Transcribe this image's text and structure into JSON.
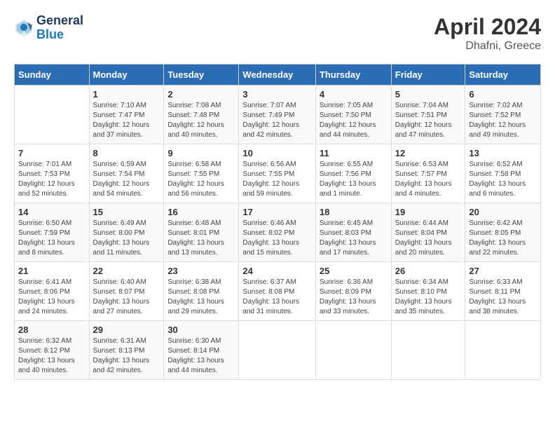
{
  "header": {
    "logo_line1": "General",
    "logo_line2": "Blue",
    "title": "April 2024",
    "subtitle": "Dhafni, Greece"
  },
  "days_of_week": [
    "Sunday",
    "Monday",
    "Tuesday",
    "Wednesday",
    "Thursday",
    "Friday",
    "Saturday"
  ],
  "weeks": [
    [
      {
        "day": "",
        "info": ""
      },
      {
        "day": "1",
        "info": "Sunrise: 7:10 AM\nSunset: 7:47 PM\nDaylight: 12 hours\nand 37 minutes."
      },
      {
        "day": "2",
        "info": "Sunrise: 7:08 AM\nSunset: 7:48 PM\nDaylight: 12 hours\nand 40 minutes."
      },
      {
        "day": "3",
        "info": "Sunrise: 7:07 AM\nSunset: 7:49 PM\nDaylight: 12 hours\nand 42 minutes."
      },
      {
        "day": "4",
        "info": "Sunrise: 7:05 AM\nSunset: 7:50 PM\nDaylight: 12 hours\nand 44 minutes."
      },
      {
        "day": "5",
        "info": "Sunrise: 7:04 AM\nSunset: 7:51 PM\nDaylight: 12 hours\nand 47 minutes."
      },
      {
        "day": "6",
        "info": "Sunrise: 7:02 AM\nSunset: 7:52 PM\nDaylight: 12 hours\nand 49 minutes."
      }
    ],
    [
      {
        "day": "7",
        "info": "Sunrise: 7:01 AM\nSunset: 7:53 PM\nDaylight: 12 hours\nand 52 minutes."
      },
      {
        "day": "8",
        "info": "Sunrise: 6:59 AM\nSunset: 7:54 PM\nDaylight: 12 hours\nand 54 minutes."
      },
      {
        "day": "9",
        "info": "Sunrise: 6:58 AM\nSunset: 7:55 PM\nDaylight: 12 hours\nand 56 minutes."
      },
      {
        "day": "10",
        "info": "Sunrise: 6:56 AM\nSunset: 7:55 PM\nDaylight: 12 hours\nand 59 minutes."
      },
      {
        "day": "11",
        "info": "Sunrise: 6:55 AM\nSunset: 7:56 PM\nDaylight: 13 hours\nand 1 minute."
      },
      {
        "day": "12",
        "info": "Sunrise: 6:53 AM\nSunset: 7:57 PM\nDaylight: 13 hours\nand 4 minutes."
      },
      {
        "day": "13",
        "info": "Sunrise: 6:52 AM\nSunset: 7:58 PM\nDaylight: 13 hours\nand 6 minutes."
      }
    ],
    [
      {
        "day": "14",
        "info": "Sunrise: 6:50 AM\nSunset: 7:59 PM\nDaylight: 13 hours\nand 8 minutes."
      },
      {
        "day": "15",
        "info": "Sunrise: 6:49 AM\nSunset: 8:00 PM\nDaylight: 13 hours\nand 11 minutes."
      },
      {
        "day": "16",
        "info": "Sunrise: 6:48 AM\nSunset: 8:01 PM\nDaylight: 13 hours\nand 13 minutes."
      },
      {
        "day": "17",
        "info": "Sunrise: 6:46 AM\nSunset: 8:02 PM\nDaylight: 13 hours\nand 15 minutes."
      },
      {
        "day": "18",
        "info": "Sunrise: 6:45 AM\nSunset: 8:03 PM\nDaylight: 13 hours\nand 17 minutes."
      },
      {
        "day": "19",
        "info": "Sunrise: 6:44 AM\nSunset: 8:04 PM\nDaylight: 13 hours\nand 20 minutes."
      },
      {
        "day": "20",
        "info": "Sunrise: 6:42 AM\nSunset: 8:05 PM\nDaylight: 13 hours\nand 22 minutes."
      }
    ],
    [
      {
        "day": "21",
        "info": "Sunrise: 6:41 AM\nSunset: 8:06 PM\nDaylight: 13 hours\nand 24 minutes."
      },
      {
        "day": "22",
        "info": "Sunrise: 6:40 AM\nSunset: 8:07 PM\nDaylight: 13 hours\nand 27 minutes."
      },
      {
        "day": "23",
        "info": "Sunrise: 6:38 AM\nSunset: 8:08 PM\nDaylight: 13 hours\nand 29 minutes."
      },
      {
        "day": "24",
        "info": "Sunrise: 6:37 AM\nSunset: 8:08 PM\nDaylight: 13 hours\nand 31 minutes."
      },
      {
        "day": "25",
        "info": "Sunrise: 6:36 AM\nSunset: 8:09 PM\nDaylight: 13 hours\nand 33 minutes."
      },
      {
        "day": "26",
        "info": "Sunrise: 6:34 AM\nSunset: 8:10 PM\nDaylight: 13 hours\nand 35 minutes."
      },
      {
        "day": "27",
        "info": "Sunrise: 6:33 AM\nSunset: 8:11 PM\nDaylight: 13 hours\nand 38 minutes."
      }
    ],
    [
      {
        "day": "28",
        "info": "Sunrise: 6:32 AM\nSunset: 8:12 PM\nDaylight: 13 hours\nand 40 minutes."
      },
      {
        "day": "29",
        "info": "Sunrise: 6:31 AM\nSunset: 8:13 PM\nDaylight: 13 hours\nand 42 minutes."
      },
      {
        "day": "30",
        "info": "Sunrise: 6:30 AM\nSunset: 8:14 PM\nDaylight: 13 hours\nand 44 minutes."
      },
      {
        "day": "",
        "info": ""
      },
      {
        "day": "",
        "info": ""
      },
      {
        "day": "",
        "info": ""
      },
      {
        "day": "",
        "info": ""
      }
    ]
  ]
}
